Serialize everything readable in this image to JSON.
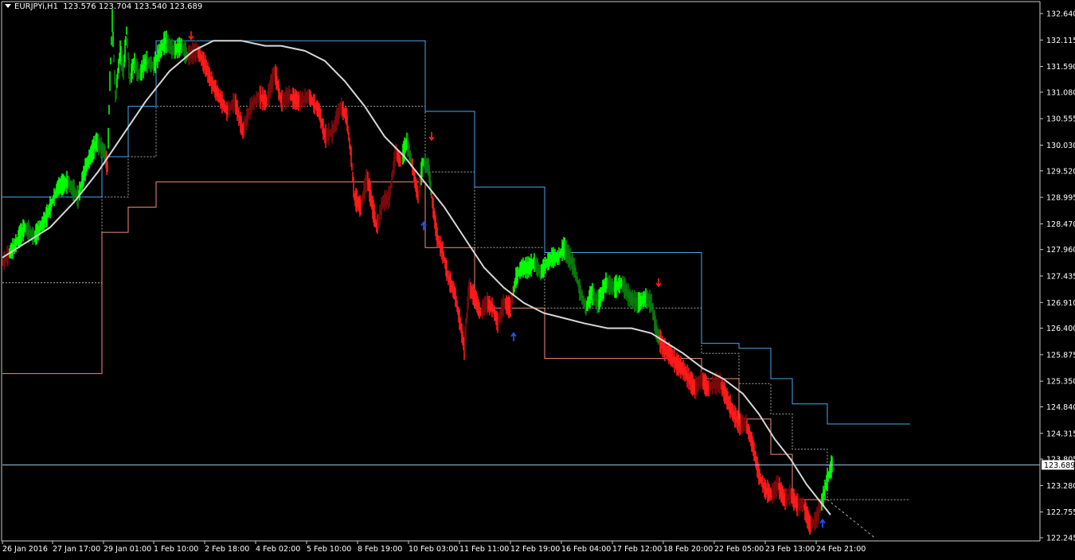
{
  "header": {
    "symbol": "EURJPYi,H1",
    "ohlc": "123.576 123.704 123.540 123.689"
  },
  "current_price": "123.689",
  "chart_data": {
    "type": "line",
    "title": "EURJPYi,H1",
    "y_axis_ticks": [
      132.64,
      132.115,
      131.59,
      131.08,
      130.555,
      130.03,
      129.52,
      128.995,
      128.47,
      127.96,
      127.435,
      126.91,
      126.4,
      125.875,
      125.35,
      124.84,
      124.315,
      123.805,
      123.28,
      122.755,
      122.245
    ],
    "y_axis_labels": [
      "132.640",
      "132.115",
      "131.590",
      "131.080",
      "130.555",
      "130.030",
      "129.520",
      "128.995",
      "128.470",
      "127.960",
      "127.435",
      "126.910",
      "126.400",
      "125.875",
      "125.350",
      "124.840",
      "124.315",
      "123.805",
      "123.280",
      "122.755",
      "122.245"
    ],
    "ylim": [
      122.245,
      132.64
    ],
    "x_axis_labels": [
      "26 Jan 2016",
      "27 Jan 17:00",
      "29 Jan 01:00",
      "1 Feb 10:00",
      "2 Feb 18:00",
      "4 Feb 02:00",
      "5 Feb 10:00",
      "8 Feb 19:00",
      "10 Feb 03:00",
      "11 Feb 11:00",
      "12 Feb 19:00",
      "16 Feb 04:00",
      "17 Feb 12:00",
      "18 Feb 20:00",
      "22 Feb 05:00",
      "23 Feb 13:00",
      "24 Feb 21:00"
    ],
    "price_path": [
      [
        0,
        127.7
      ],
      [
        14,
        128.0
      ],
      [
        28,
        128.4
      ],
      [
        40,
        128.2
      ],
      [
        55,
        128.6
      ],
      [
        70,
        129.2
      ],
      [
        82,
        129.3
      ],
      [
        95,
        129.0
      ],
      [
        105,
        129.6
      ],
      [
        118,
        130.1
      ],
      [
        128,
        129.9
      ],
      [
        132,
        129.6
      ],
      [
        135,
        131.3
      ],
      [
        138,
        132.5
      ],
      [
        142,
        131.0
      ],
      [
        148,
        131.9
      ],
      [
        152,
        131.5
      ],
      [
        156,
        132.3
      ],
      [
        160,
        131.3
      ],
      [
        165,
        131.7
      ],
      [
        172,
        131.4
      ],
      [
        180,
        131.7
      ],
      [
        190,
        131.6
      ],
      [
        198,
        131.9
      ],
      [
        205,
        132.1
      ],
      [
        215,
        131.9
      ],
      [
        225,
        132.0
      ],
      [
        232,
        131.8
      ],
      [
        245,
        131.9
      ],
      [
        255,
        131.6
      ],
      [
        262,
        131.3
      ],
      [
        272,
        131.0
      ],
      [
        282,
        130.7
      ],
      [
        292,
        130.9
      ],
      [
        302,
        130.3
      ],
      [
        312,
        130.8
      ],
      [
        322,
        131.0
      ],
      [
        332,
        130.9
      ],
      [
        342,
        131.5
      ],
      [
        350,
        130.9
      ],
      [
        360,
        131.0
      ],
      [
        372,
        130.9
      ],
      [
        385,
        131.0
      ],
      [
        398,
        130.7
      ],
      [
        405,
        130.2
      ],
      [
        415,
        130.3
      ],
      [
        425,
        130.8
      ],
      [
        432,
        130.6
      ],
      [
        438,
        129.8
      ],
      [
        442,
        129.0
      ],
      [
        450,
        128.8
      ],
      [
        458,
        129.4
      ],
      [
        465,
        128.8
      ],
      [
        470,
        128.4
      ],
      [
        478,
        128.9
      ],
      [
        486,
        129.0
      ],
      [
        494,
        129.9
      ],
      [
        500,
        129.7
      ],
      [
        508,
        130.1
      ],
      [
        515,
        129.6
      ],
      [
        522,
        129.0
      ],
      [
        528,
        129.7
      ],
      [
        535,
        129.6
      ],
      [
        540,
        128.9
      ],
      [
        546,
        128.2
      ],
      [
        553,
        127.9
      ],
      [
        560,
        127.4
      ],
      [
        568,
        127.1
      ],
      [
        576,
        126.4
      ],
      [
        580,
        126.0
      ],
      [
        586,
        127.2
      ],
      [
        594,
        127.0
      ],
      [
        600,
        126.7
      ],
      [
        608,
        126.9
      ],
      [
        616,
        126.8
      ],
      [
        622,
        126.5
      ],
      [
        630,
        126.9
      ],
      [
        638,
        126.8
      ],
      [
        645,
        127.4
      ],
      [
        652,
        127.6
      ],
      [
        660,
        127.6
      ],
      [
        668,
        127.7
      ],
      [
        676,
        127.5
      ],
      [
        684,
        127.7
      ],
      [
        690,
        127.8
      ],
      [
        698,
        127.8
      ],
      [
        705,
        128.0
      ],
      [
        712,
        127.8
      ],
      [
        718,
        127.6
      ],
      [
        726,
        127.1
      ],
      [
        733,
        126.8
      ],
      [
        740,
        127.1
      ],
      [
        748,
        126.9
      ],
      [
        758,
        127.3
      ],
      [
        768,
        127.2
      ],
      [
        778,
        127.3
      ],
      [
        788,
        127.0
      ],
      [
        798,
        126.9
      ],
      [
        808,
        127.0
      ],
      [
        815,
        126.9
      ],
      [
        822,
        126.3
      ],
      [
        830,
        126.0
      ],
      [
        838,
        125.9
      ],
      [
        846,
        125.7
      ],
      [
        854,
        125.6
      ],
      [
        862,
        125.4
      ],
      [
        870,
        125.2
      ],
      [
        878,
        125.4
      ],
      [
        886,
        125.2
      ],
      [
        894,
        125.3
      ],
      [
        902,
        125.3
      ],
      [
        910,
        125.0
      ],
      [
        918,
        124.7
      ],
      [
        926,
        124.5
      ],
      [
        934,
        124.5
      ],
      [
        942,
        124.1
      ],
      [
        950,
        123.5
      ],
      [
        958,
        123.2
      ],
      [
        966,
        123.1
      ],
      [
        974,
        123.3
      ],
      [
        982,
        123.0
      ],
      [
        990,
        123.1
      ],
      [
        998,
        122.9
      ],
      [
        1006,
        122.9
      ],
      [
        1014,
        122.5
      ],
      [
        1022,
        122.6
      ],
      [
        1030,
        123.0
      ],
      [
        1036,
        123.4
      ],
      [
        1042,
        123.7
      ]
    ],
    "moving_average": [
      [
        0,
        127.8
      ],
      [
        30,
        128.1
      ],
      [
        60,
        128.4
      ],
      [
        90,
        128.9
      ],
      [
        120,
        129.5
      ],
      [
        150,
        130.2
      ],
      [
        180,
        130.9
      ],
      [
        210,
        131.5
      ],
      [
        240,
        131.9
      ],
      [
        265,
        132.1
      ],
      [
        300,
        132.1
      ],
      [
        330,
        132.0
      ],
      [
        350,
        132.0
      ],
      [
        380,
        131.9
      ],
      [
        405,
        131.7
      ],
      [
        430,
        131.3
      ],
      [
        455,
        130.8
      ],
      [
        480,
        130.2
      ],
      [
        505,
        129.8
      ],
      [
        530,
        129.3
      ],
      [
        555,
        128.8
      ],
      [
        580,
        128.2
      ],
      [
        605,
        127.6
      ],
      [
        630,
        127.2
      ],
      [
        655,
        126.9
      ],
      [
        680,
        126.7
      ],
      [
        705,
        126.6
      ],
      [
        730,
        126.5
      ],
      [
        760,
        126.4
      ],
      [
        790,
        126.4
      ],
      [
        815,
        126.3
      ],
      [
        835,
        126.1
      ],
      [
        855,
        125.9
      ],
      [
        880,
        125.6
      ],
      [
        905,
        125.4
      ],
      [
        930,
        125.1
      ],
      [
        950,
        124.7
      ],
      [
        970,
        124.2
      ],
      [
        990,
        123.8
      ],
      [
        1010,
        123.3
      ],
      [
        1030,
        122.9
      ],
      [
        1040,
        122.7
      ]
    ],
    "upper_channel": [
      [
        0,
        129.0
      ],
      [
        125,
        129.0
      ],
      [
        125,
        129.8
      ],
      [
        158,
        129.8
      ],
      [
        158,
        130.8
      ],
      [
        193,
        130.8
      ],
      [
        193,
        132.1
      ],
      [
        531,
        132.1
      ],
      [
        531,
        130.7
      ],
      [
        593,
        130.7
      ],
      [
        593,
        129.2
      ],
      [
        681,
        129.2
      ],
      [
        681,
        127.9
      ],
      [
        878,
        127.9
      ],
      [
        878,
        126.1
      ],
      [
        925,
        126.1
      ],
      [
        925,
        126.0
      ],
      [
        965,
        126.0
      ],
      [
        965,
        125.4
      ],
      [
        992,
        125.4
      ],
      [
        992,
        124.9
      ],
      [
        1036,
        124.9
      ],
      [
        1036,
        124.5
      ],
      [
        1140,
        124.5
      ]
    ],
    "lower_channel": [
      [
        0,
        125.5
      ],
      [
        125,
        125.5
      ],
      [
        125,
        128.3
      ],
      [
        158,
        128.3
      ],
      [
        158,
        128.8
      ],
      [
        193,
        128.8
      ],
      [
        193,
        129.3
      ],
      [
        531,
        129.3
      ],
      [
        531,
        128.0
      ],
      [
        593,
        128.0
      ],
      [
        593,
        126.8
      ],
      [
        681,
        126.8
      ],
      [
        681,
        125.8
      ],
      [
        878,
        125.8
      ],
      [
        878,
        125.4
      ],
      [
        925,
        125.4
      ],
      [
        925,
        124.6
      ],
      [
        965,
        124.6
      ],
      [
        965,
        123.9
      ],
      [
        992,
        123.9
      ],
      [
        992,
        123.0
      ],
      [
        1036,
        123.0
      ]
    ],
    "mid_channel": [
      [
        0,
        127.3
      ],
      [
        125,
        127.3
      ],
      [
        125,
        129.0
      ],
      [
        158,
        129.0
      ],
      [
        158,
        129.8
      ],
      [
        193,
        129.8
      ],
      [
        193,
        130.8
      ],
      [
        531,
        130.8
      ],
      [
        531,
        129.5
      ],
      [
        593,
        129.5
      ],
      [
        593,
        128.0
      ],
      [
        681,
        128.0
      ],
      [
        681,
        126.8
      ],
      [
        878,
        126.8
      ],
      [
        878,
        125.9
      ],
      [
        925,
        125.9
      ],
      [
        925,
        125.3
      ],
      [
        965,
        125.3
      ],
      [
        965,
        124.7
      ],
      [
        992,
        124.7
      ],
      [
        992,
        124.0
      ],
      [
        1036,
        124.0
      ],
      [
        1036,
        123.0
      ],
      [
        1140,
        123.0
      ]
    ],
    "projection_line": [
      [
        1036,
        123.0
      ],
      [
        1095,
        122.25
      ]
    ],
    "sell_arrows": [
      [
        237,
        132.1
      ],
      [
        539,
        130.1
      ],
      [
        824,
        127.2
      ]
    ],
    "buy_arrows": [
      [
        529,
        128.5
      ],
      [
        642,
        126.3
      ],
      [
        1030,
        122.6
      ]
    ]
  },
  "colors": {
    "background": "#000000",
    "text": "#ffffff",
    "bull_strong": "#00ff00",
    "bull_weak": "#0a7a0a",
    "bear_strong": "#ff1a1a",
    "bear_weak": "#7a0a0a",
    "moving_average": "#d8d8d8",
    "upper_channel": "#4aa8e8",
    "lower_channel": "#f0907a",
    "mid_channel": "#aaaaaa",
    "current_price_line": "#9fc0e0",
    "sell_arrow": "#ff2020",
    "buy_arrow": "#2050ff",
    "axis": "#cccccc"
  }
}
